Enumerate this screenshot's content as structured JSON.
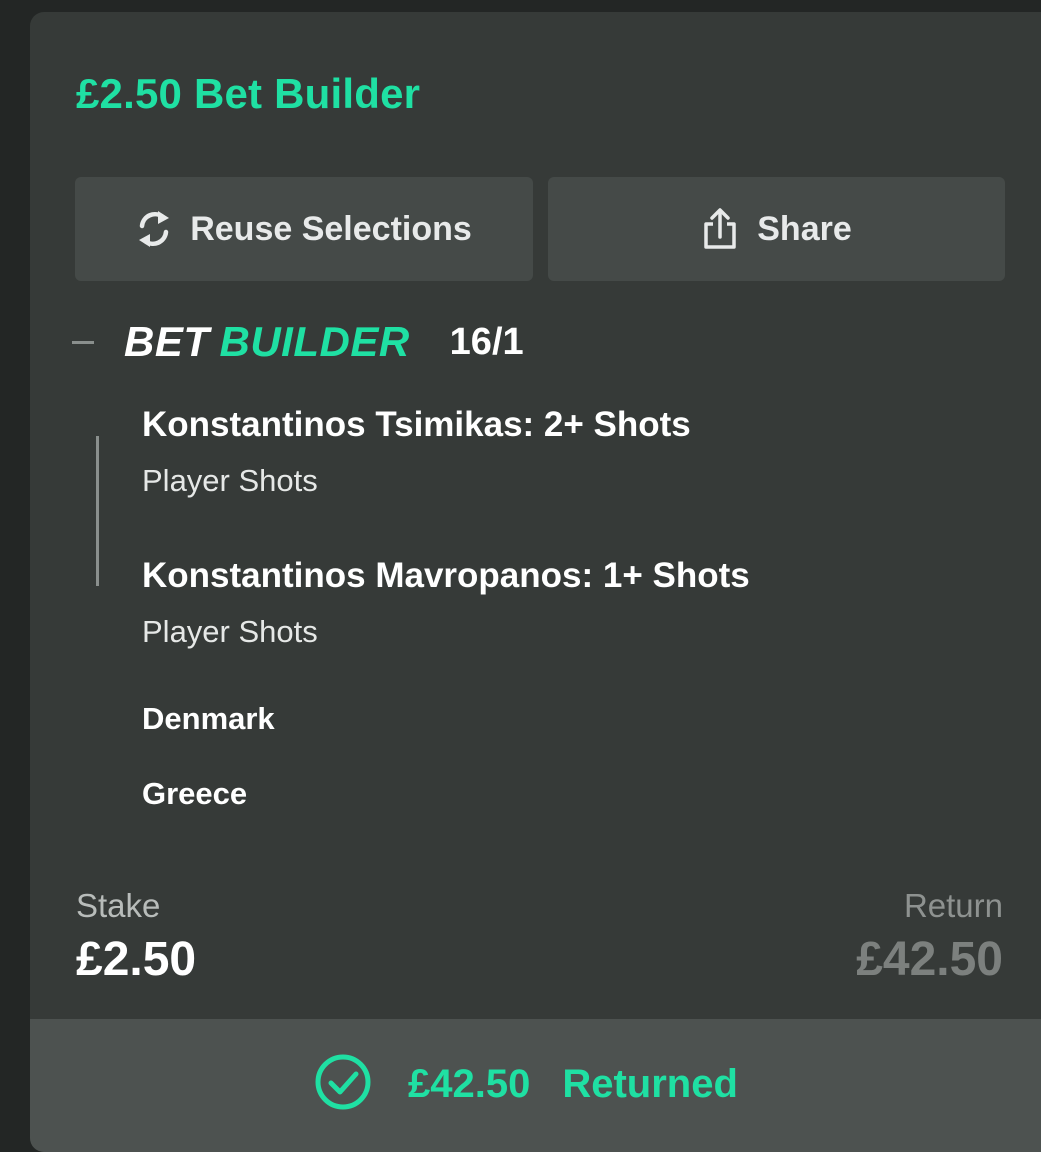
{
  "header": {
    "title": "£2.50 Bet Builder"
  },
  "actions": {
    "reuse_label": "Reuse Selections",
    "share_label": "Share"
  },
  "bet": {
    "logo_bet": "BET",
    "logo_builder": "BUILDER",
    "odds": "16/1",
    "selections": [
      {
        "name": "Konstantinos Tsimikas: 2+ Shots",
        "market": "Player Shots"
      },
      {
        "name": "Konstantinos Mavropanos: 1+ Shots",
        "market": "Player Shots"
      }
    ],
    "teams": [
      "Denmark",
      "Greece"
    ]
  },
  "summary": {
    "stake_label": "Stake",
    "stake_value": "£2.50",
    "return_label": "Return",
    "return_value": "£42.50"
  },
  "result": {
    "amount": "£42.50",
    "label": "Returned"
  },
  "colors": {
    "accent": "#1fe0a3",
    "card": "#363a38",
    "button": "#454a48",
    "footer": "#4d5250",
    "background": "#232625"
  },
  "icons": {
    "reuse": "refresh-icon",
    "share": "share-icon",
    "result": "check-circle-icon"
  }
}
